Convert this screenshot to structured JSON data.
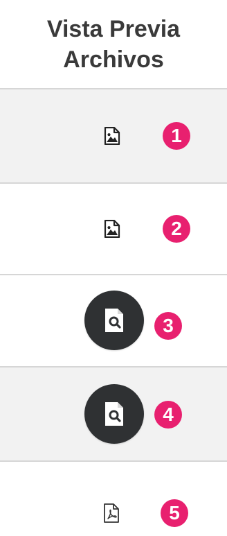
{
  "header": {
    "title_line1": "Vista Previa",
    "title_line2": "Archivos"
  },
  "rows": [
    {
      "icon": "image-file-icon",
      "badge": "1"
    },
    {
      "icon": "image-file-icon",
      "badge": "2"
    },
    {
      "icon": "file-search-icon",
      "badge": "3"
    },
    {
      "icon": "file-search-icon",
      "badge": "4"
    },
    {
      "icon": "pdf-file-icon",
      "badge": "5"
    }
  ],
  "colors": {
    "badge": "#e8206f",
    "fab": "#2f3133",
    "row_shaded": "#f2f2f2",
    "header_text": "#3a3a3a"
  }
}
